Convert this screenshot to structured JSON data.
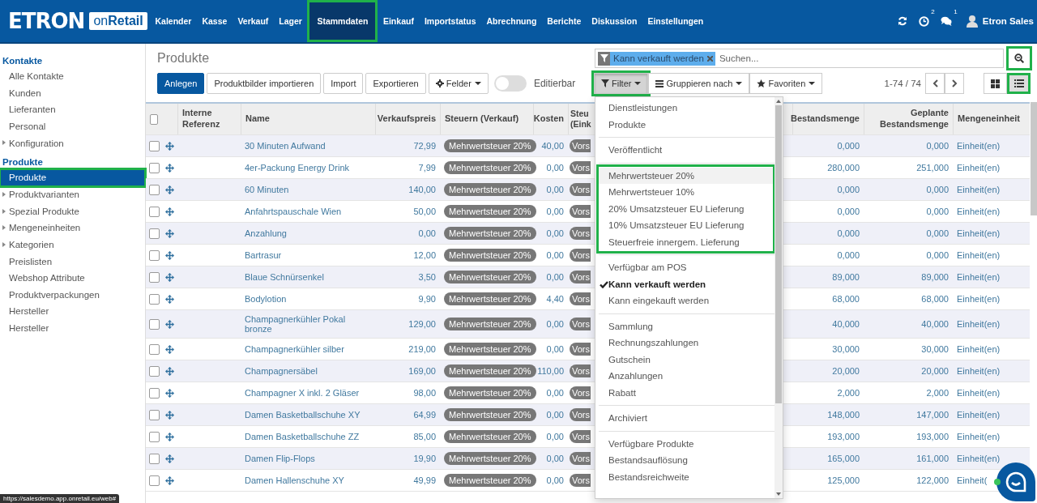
{
  "navbar": {
    "logo": {
      "brand": "ETRON",
      "product": "on**Retail**"
    },
    "menu": [
      {
        "label": "Kalender",
        "selected": false,
        "highlighted": false
      },
      {
        "label": "Kasse",
        "selected": false,
        "highlighted": false
      },
      {
        "label": "Verkauf",
        "selected": false,
        "highlighted": false
      },
      {
        "label": "Lager",
        "selected": false,
        "highlighted": false
      },
      {
        "label": "Stammdaten",
        "selected": true,
        "highlighted": true
      },
      {
        "label": "Einkauf",
        "selected": false,
        "highlighted": false
      },
      {
        "label": "Importstatus",
        "selected": false,
        "highlighted": false
      },
      {
        "label": "Abrechnung",
        "selected": false,
        "highlighted": false
      },
      {
        "label": "Berichte",
        "selected": false,
        "highlighted": false
      },
      {
        "label": "Diskussion",
        "selected": false,
        "highlighted": false
      },
      {
        "label": "Einstellungen",
        "selected": false,
        "highlighted": false
      }
    ],
    "systray": [
      {
        "kind": "refresh"
      },
      {
        "kind": "activity",
        "count": "2"
      },
      {
        "kind": "chat",
        "count": "1"
      }
    ],
    "user": "Etron Sales"
  },
  "sidebar": [
    {
      "title": "Kontakte",
      "items": [
        {
          "label": "Alle Kontakte",
          "selected": false,
          "expandable": false,
          "highlighted": false
        },
        {
          "label": "Kunden",
          "selected": false,
          "expandable": false,
          "highlighted": false
        },
        {
          "label": "Lieferanten",
          "selected": false,
          "expandable": false,
          "highlighted": false
        },
        {
          "label": "Personal",
          "selected": false,
          "expandable": false,
          "highlighted": false
        },
        {
          "label": "Konfiguration",
          "selected": false,
          "expandable": true,
          "highlighted": false
        }
      ]
    },
    {
      "title": "Produkte",
      "items": [
        {
          "label": "Produkte",
          "selected": true,
          "expandable": false,
          "highlighted": true
        },
        {
          "label": "Produktvarianten",
          "selected": false,
          "expandable": true,
          "highlighted": false
        },
        {
          "label": "Spezial Produkte",
          "selected": false,
          "expandable": true,
          "highlighted": false
        },
        {
          "label": "Mengeneinheiten",
          "selected": false,
          "expandable": true,
          "highlighted": false
        },
        {
          "label": "Kategorien",
          "selected": false,
          "expandable": true,
          "highlighted": false
        },
        {
          "label": "Preislisten",
          "selected": false,
          "expandable": false,
          "highlighted": false
        },
        {
          "label": "Webshop Attribute",
          "selected": false,
          "expandable": false,
          "highlighted": false
        },
        {
          "label": "Produktverpackungen",
          "selected": false,
          "expandable": false,
          "highlighted": false
        },
        {
          "label": "Hersteller",
          "selected": false,
          "expandable": false,
          "highlighted": false
        },
        {
          "label": "Hersteller",
          "selected": false,
          "expandable": false,
          "highlighted": false
        }
      ]
    }
  ],
  "control_panel": {
    "title": "Produkte",
    "search": {
      "facets": [
        {
          "label": "Kann verkauft werden"
        }
      ],
      "placeholder": "Suchen...",
      "button_highlighted": true
    },
    "buttons": [
      {
        "label": "Anlegen",
        "kind": "primary"
      },
      {
        "label": "Produktbilder importieren",
        "kind": "default"
      },
      {
        "label": "Import",
        "kind": "default"
      },
      {
        "label": "Exportieren",
        "kind": "default"
      },
      {
        "label": "Felder",
        "kind": "fields"
      }
    ],
    "toggle": {
      "label": "Editierbar",
      "on": false
    },
    "search_options": [
      {
        "label": "Filter",
        "kind": "filter",
        "pressed": true,
        "highlighted": true
      },
      {
        "label": "Gruppieren nach",
        "kind": "group",
        "pressed": false,
        "highlighted": false
      },
      {
        "label": "Favoriten",
        "kind": "favorites",
        "pressed": false,
        "highlighted": false
      }
    ],
    "pager": "1-74 / 74",
    "views": [
      {
        "kind": "kanban",
        "selected": false,
        "highlighted": false
      },
      {
        "kind": "list",
        "selected": true,
        "highlighted": true
      }
    ]
  },
  "filter_menu": [
    {
      "highlighted": false,
      "items": [
        {
          "label": "Dienstleistungen",
          "checked": false,
          "hovered": false
        },
        {
          "label": "Produkte",
          "checked": false,
          "hovered": false
        }
      ]
    },
    {
      "highlighted": false,
      "items": [
        {
          "label": "Veröffentlicht",
          "checked": false,
          "hovered": false
        }
      ]
    },
    {
      "highlighted": true,
      "items": [
        {
          "label": "Mehrwertsteuer 20%",
          "checked": false,
          "hovered": true
        },
        {
          "label": "Mehrwertsteuer 10%",
          "checked": false,
          "hovered": false
        },
        {
          "label": "20% Umsatzsteuer EU Lieferung",
          "checked": false,
          "hovered": false
        },
        {
          "label": "10% Umsatzsteuer EU Lieferung",
          "checked": false,
          "hovered": false
        },
        {
          "label": "Steuerfreie innergem. Lieferung",
          "checked": false,
          "hovered": false
        }
      ]
    },
    {
      "highlighted": false,
      "items": [
        {
          "label": "Verfügbar am POS",
          "checked": false,
          "hovered": false
        },
        {
          "label": "Kann verkauft werden",
          "checked": true,
          "hovered": false
        },
        {
          "label": "Kann eingekauft werden",
          "checked": false,
          "hovered": false
        }
      ]
    },
    {
      "highlighted": false,
      "items": [
        {
          "label": "Sammlung",
          "checked": false,
          "hovered": false
        },
        {
          "label": "Rechnungszahlungen",
          "checked": false,
          "hovered": false
        },
        {
          "label": "Gutschein",
          "checked": false,
          "hovered": false
        },
        {
          "label": "Anzahlungen",
          "checked": false,
          "hovered": false
        },
        {
          "label": "Rabatt",
          "checked": false,
          "hovered": false
        }
      ]
    },
    {
      "highlighted": false,
      "items": [
        {
          "label": "Archiviert",
          "checked": false,
          "hovered": false
        }
      ]
    },
    {
      "highlighted": false,
      "items": [
        {
          "label": "Verfügbare Produkte",
          "checked": false,
          "hovered": false
        },
        {
          "label": "Bestandsauflösung",
          "checked": false,
          "hovered": false
        },
        {
          "label": "Bestandsreichweite",
          "checked": false,
          "hovered": false
        }
      ]
    }
  ],
  "table": {
    "header_checked": false,
    "columns": [
      "Interne Referenz",
      "Name",
      "Verkaufspreis",
      "Steuern (Verkauf)",
      "Kosten",
      "Steu (Eink",
      "Bestandsmenge",
      "Geplante Bestandsmenge",
      "Mengeneinheit"
    ],
    "rows": [
      {
        "checked": false,
        "name": "30 Minuten Aufwand",
        "price": "72,99",
        "tax": "Mehrwertsteuer 20%",
        "cost": "40,00",
        "purchase_tax": "Vors",
        "stock": "0,000",
        "planned": "0,000",
        "uom": "Einheit(en)"
      },
      {
        "checked": false,
        "name": "4er-Packung Energy Drink",
        "price": "7,99",
        "tax": "Mehrwertsteuer 20%",
        "cost": "0,00",
        "purchase_tax": "Vors",
        "stock": "280,000",
        "planned": "251,000",
        "uom": "Einheit(en)"
      },
      {
        "checked": false,
        "name": "60 Minuten",
        "price": "140,00",
        "tax": "Mehrwertsteuer 20%",
        "cost": "0,00",
        "purchase_tax": "Vors",
        "stock": "0,000",
        "planned": "0,000",
        "uom": "Einheit(en)"
      },
      {
        "checked": false,
        "name": "Anfahrtspauschale Wien",
        "price": "50,00",
        "tax": "Mehrwertsteuer 20%",
        "cost": "0,00",
        "purchase_tax": "Vors",
        "stock": "0,000",
        "planned": "0,000",
        "uom": "Einheit(en)"
      },
      {
        "checked": false,
        "name": "Anzahlung",
        "price": "0,00",
        "tax": "Mehrwertsteuer 20%",
        "cost": "0,00",
        "purchase_tax": "Vors",
        "stock": "0,000",
        "planned": "0,000",
        "uom": "Einheit(en)"
      },
      {
        "checked": false,
        "name": "Bartrasur",
        "price": "12,00",
        "tax": "Mehrwertsteuer 20%",
        "cost": "0,00",
        "purchase_tax": "Vors",
        "stock": "0,000",
        "planned": "0,000",
        "uom": "Einheit(en)"
      },
      {
        "checked": false,
        "name": "Blaue Schnürsenkel",
        "price": "3,50",
        "tax": "Mehrwertsteuer 20%",
        "cost": "0,00",
        "purchase_tax": "Vors",
        "stock": "89,000",
        "planned": "89,000",
        "uom": "Einheit(en)"
      },
      {
        "checked": false,
        "name": "Bodylotion",
        "price": "9,90",
        "tax": "Mehrwertsteuer 20%",
        "cost": "4,40",
        "purchase_tax": "Vors",
        "stock": "68,000",
        "planned": "68,000",
        "uom": "Einheit(en)"
      },
      {
        "checked": false,
        "name": "Champagnerkühler Pokal bronze",
        "price": "129,00",
        "tax": "Mehrwertsteuer 20%",
        "cost": "0,00",
        "purchase_tax": "Vors",
        "stock": "40,000",
        "planned": "40,000",
        "uom": "Einheit(en)"
      },
      {
        "checked": false,
        "name": "Champagnerkühler silber",
        "price": "219,00",
        "tax": "Mehrwertsteuer 20%",
        "cost": "0,00",
        "purchase_tax": "Vors",
        "stock": "30,000",
        "planned": "30,000",
        "uom": "Einheit(en)"
      },
      {
        "checked": false,
        "name": "Champagnersäbel",
        "price": "169,00",
        "tax": "Mehrwertsteuer 20%",
        "cost": "110,00",
        "purchase_tax": "Vors",
        "stock": "20,000",
        "planned": "20,000",
        "uom": "Einheit(en)"
      },
      {
        "checked": false,
        "name": "Champagner X inkl. 2 Gläser",
        "price": "98,00",
        "tax": "Mehrwertsteuer 20%",
        "cost": "0,00",
        "purchase_tax": "Vors",
        "stock": "2,000",
        "planned": "2,000",
        "uom": "Einheit(en)"
      },
      {
        "checked": false,
        "name": "Damen Basketballschuhe XY",
        "price": "64,99",
        "tax": "Mehrwertsteuer 20%",
        "cost": "0,00",
        "purchase_tax": "Vors",
        "stock": "148,000",
        "planned": "147,000",
        "uom": "Einheit(en)"
      },
      {
        "checked": false,
        "name": "Damen Basketballschuhe ZZ",
        "price": "85,00",
        "tax": "Mehrwertsteuer 20%",
        "cost": "0,00",
        "purchase_tax": "Vors",
        "stock": "193,000",
        "planned": "193,000",
        "uom": "Einheit(en)"
      },
      {
        "checked": false,
        "name": "Damen Flip-Flops",
        "price": "19,90",
        "tax": "Mehrwertsteuer 20%",
        "cost": "0,00",
        "purchase_tax": "Vors",
        "stock": "165,000",
        "planned": "161,000",
        "uom": "Einheit(en)"
      },
      {
        "checked": false,
        "name": "Damen Hallenschuhe XY",
        "price": "49,99",
        "tax": "Mehrwertsteuer 20%",
        "cost": "0,00",
        "purchase_tax": "Vors",
        "stock": "125,000",
        "planned": "122,000",
        "uom": "Einheit("
      }
    ]
  },
  "status_url": "https://salesdemo.app.onretail.eu/web#"
}
